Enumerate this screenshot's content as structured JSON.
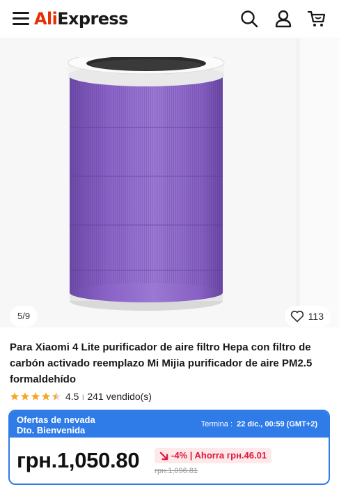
{
  "header": {
    "logo_text_brand": "Ali",
    "logo_text_rest": "Express",
    "icons": [
      "menu-icon",
      "search-icon",
      "account-icon",
      "cart-icon"
    ]
  },
  "gallery": {
    "counter": "5/9",
    "wishlist_count": "113"
  },
  "product": {
    "title": "Para Xiaomi 4 Lite purificador de aire filtro Hepa con filtro de carbón activado reemplazo Mi Mijia purificador de aire PM2.5 formaldehído",
    "rating": "4.5",
    "rating_fraction": 0.9,
    "separator": "ı",
    "sold": "241 vendido(s)"
  },
  "promo": {
    "label_line1": "Ofertas de nevada",
    "label_line2": "Dto. Bienvenida",
    "ends_label": "Termina :",
    "ends_value": "22 dic., 00:59 (GMT+2)",
    "price": "грн.1,050.80",
    "discount": "-4% | Ahorra грн.46.01",
    "old_price": "грн.1,096.81"
  },
  "colors": {
    "brand_red": "#e62e04",
    "promo_blue": "#2f7be8",
    "discount_red": "#e0183c",
    "star_gold": "#f5a623",
    "filter_purple": "#8a63c7"
  }
}
